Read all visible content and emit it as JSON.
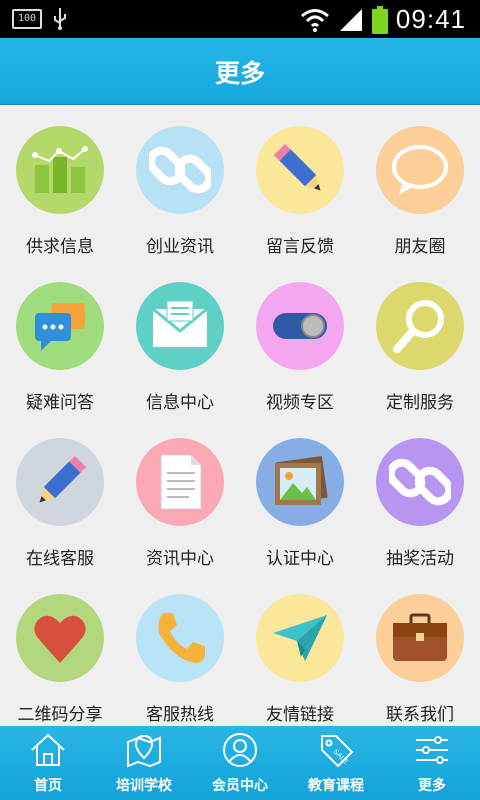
{
  "status_bar": {
    "battery_small": "100",
    "time": "09:41"
  },
  "header": {
    "title": "更多"
  },
  "grid": {
    "items": [
      {
        "label": "供求信息",
        "icon": "bar-chart-icon",
        "color": "#b5d86a"
      },
      {
        "label": "创业资讯",
        "icon": "link-icon",
        "color": "#b7e2f6"
      },
      {
        "label": "留言反馈",
        "icon": "pencil-icon",
        "color": "#fbe79a"
      },
      {
        "label": "朋友圈",
        "icon": "chat-bubble-icon",
        "color": "#fbcf97"
      },
      {
        "label": "疑难问答",
        "icon": "chat-bubbles-icon",
        "color": "#9fdc7d"
      },
      {
        "label": "信息中心",
        "icon": "envelope-icon",
        "color": "#5fd0c5"
      },
      {
        "label": "视频专区",
        "icon": "toggle-icon",
        "color": "#f5a6f0"
      },
      {
        "label": "定制服务",
        "icon": "magnifier-icon",
        "color": "#dcd86e"
      },
      {
        "label": "在线客服",
        "icon": "pencil-icon",
        "color": "#cfd6de"
      },
      {
        "label": "资讯中心",
        "icon": "document-icon",
        "color": "#fba8b5"
      },
      {
        "label": "认证中心",
        "icon": "picture-icon",
        "color": "#86aee5"
      },
      {
        "label": "抽奖活动",
        "icon": "link-icon",
        "color": "#b796f2"
      },
      {
        "label": "二维码分享",
        "icon": "heart-icon",
        "color": "#b2d77c"
      },
      {
        "label": "客服热线",
        "icon": "phone-icon",
        "color": "#b9e3f6"
      },
      {
        "label": "友情链接",
        "icon": "paper-plane-icon",
        "color": "#fbe79a"
      },
      {
        "label": "联系我们",
        "icon": "briefcase-icon",
        "color": "#fbcf97"
      }
    ]
  },
  "tabbar": {
    "tabs": [
      {
        "label": "首页",
        "icon": "home-icon"
      },
      {
        "label": "培训学校",
        "icon": "map-icon"
      },
      {
        "label": "会员中心",
        "icon": "user-icon"
      },
      {
        "label": "教育课程",
        "icon": "sale-tag-icon"
      },
      {
        "label": "更多",
        "icon": "sliders-icon"
      }
    ]
  }
}
